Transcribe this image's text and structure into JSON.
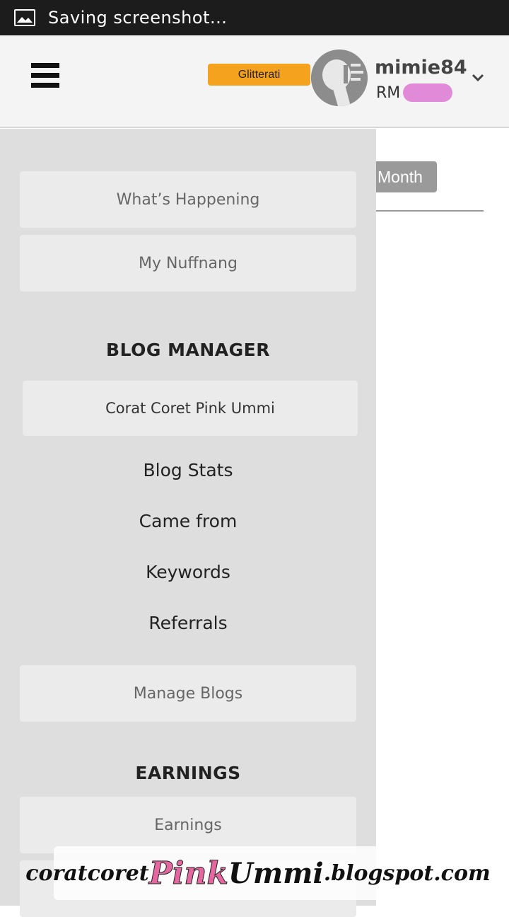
{
  "status_bar": {
    "text": "Saving screenshot..."
  },
  "header": {
    "badge": "Glitterati",
    "username": "mimie84",
    "currency": "RM"
  },
  "content": {
    "month_button": "Month"
  },
  "drawer": {
    "whats_happening": "What’s Happening",
    "my_nuffnang": "My Nuffnang",
    "blog_manager_title": "BLOG MANAGER",
    "blog_name": "Corat Coret Pink Ummi",
    "blog_links": [
      "Blog Stats",
      "Came from",
      "Keywords",
      "Referrals"
    ],
    "manage_blogs": "Manage Blogs",
    "earnings_title": "EARNINGS",
    "earnings": "Earnings"
  },
  "watermark": {
    "prefix": "coratcoret",
    "pink": "Pink",
    "ummi": "Ummi",
    "suffix": ".blogspot.com"
  },
  "colors": {
    "status_bar": "#1c1c1c",
    "badge": "#f5a31f",
    "drawer_bg": "#dedede",
    "card_bg": "#ebebeb",
    "month_button": "#9a9a9a",
    "watermark_pink": "#e4679f"
  }
}
